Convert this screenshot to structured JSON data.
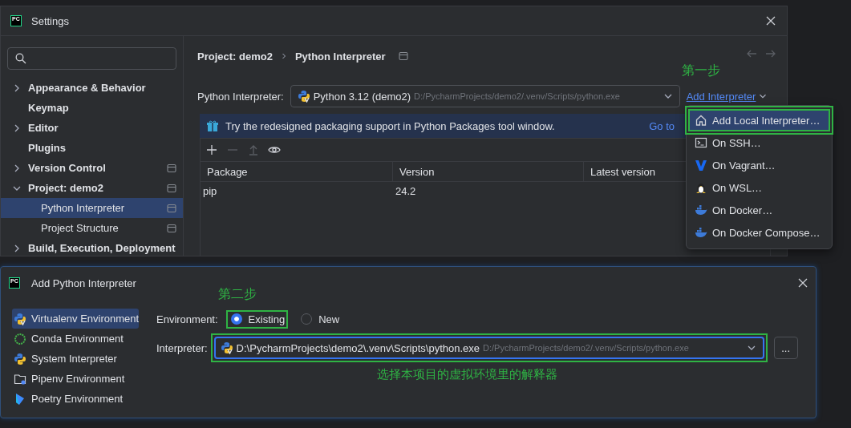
{
  "settings": {
    "logo": "PC",
    "title": "Settings",
    "sidebar": {
      "items": [
        {
          "label": "Appearance & Behavior",
          "kind": "group",
          "expanded": false,
          "selected": false,
          "scope_icon": false
        },
        {
          "label": "Keymap",
          "kind": "page",
          "selected": false,
          "scope_icon": false
        },
        {
          "label": "Editor",
          "kind": "group",
          "expanded": false,
          "selected": false,
          "scope_icon": false
        },
        {
          "label": "Plugins",
          "kind": "page",
          "selected": false,
          "scope_icon": false
        },
        {
          "label": "Version Control",
          "kind": "group",
          "expanded": false,
          "selected": false,
          "scope_icon": true
        },
        {
          "label": "Project: demo2",
          "kind": "group",
          "expanded": true,
          "selected": false,
          "scope_icon": true,
          "children": [
            {
              "label": "Python Interpreter",
              "kind": "page",
              "selected": true,
              "scope_icon": true
            },
            {
              "label": "Project Structure",
              "kind": "page",
              "selected": false,
              "scope_icon": true
            }
          ]
        },
        {
          "label": "Build, Execution, Deployment",
          "kind": "group",
          "expanded": false,
          "selected": false,
          "scope_icon": false
        }
      ]
    },
    "breadcrumb": [
      "Project: demo2",
      "Python Interpreter"
    ],
    "interpreter": {
      "label": "Python Interpreter:",
      "value": "Python 3.12 (demo2)",
      "path": "D:/PycharmProjects/demo2/.venv/Scripts/python.exe"
    },
    "add_interpreter": {
      "label": "Add Interpreter",
      "annotation": "第一步"
    },
    "banner": {
      "text": "Try the redesigned packaging support in Python Packages tool window.",
      "link": "Go to"
    },
    "toolbar": [
      {
        "kind": "add",
        "disabled": false
      },
      {
        "kind": "remove",
        "disabled": true
      },
      {
        "kind": "upgrade",
        "disabled": true
      },
      {
        "kind": "show",
        "disabled": false
      }
    ],
    "table": {
      "columns": [
        "Package",
        "Version",
        "Latest version"
      ],
      "rows": [
        [
          "pip",
          "24.2"
        ]
      ]
    }
  },
  "menu": {
    "items": [
      {
        "label": "Add Local Interpreter…",
        "kind": "home",
        "selected": true,
        "annotated": true
      },
      {
        "label": "On SSH…",
        "kind": "terminal",
        "selected": false,
        "annotated": false
      },
      {
        "label": "On Vagrant…",
        "kind": "vagrant",
        "selected": false,
        "annotated": false
      },
      {
        "label": "On WSL…",
        "kind": "penguin",
        "selected": false,
        "annotated": false
      },
      {
        "label": "On Docker…",
        "kind": "docker",
        "selected": false,
        "annotated": false
      },
      {
        "label": "On Docker Compose…",
        "kind": "docker",
        "selected": false,
        "annotated": false
      }
    ]
  },
  "dialog": {
    "logo": "PC",
    "title": "Add Python Interpreter",
    "sidebar": {
      "items": [
        {
          "label": "Virtualenv Environment",
          "kind": "virtualenv",
          "selected": true
        },
        {
          "label": "Conda Environment",
          "kind": "conda",
          "selected": false
        },
        {
          "label": "System Interpreter",
          "kind": "python",
          "selected": false
        },
        {
          "label": "Pipenv Environment",
          "kind": "pipenv",
          "selected": false
        },
        {
          "label": "Poetry Environment",
          "kind": "poetry",
          "selected": false
        }
      ]
    },
    "annotation": "第二步",
    "environment": {
      "label": "Environment:",
      "options": [
        {
          "label": "Existing",
          "selected": true,
          "annotated": true
        },
        {
          "label": "New",
          "selected": false,
          "annotated": false
        }
      ]
    },
    "interpreter": {
      "label": "Interpreter:",
      "value": "D:\\PycharmProjects\\demo2\\.venv\\Scripts\\python.exe",
      "path": "D:/PycharmProjects/demo2/.venv/Scripts/python.exe",
      "annotated": true,
      "browse": "..."
    },
    "note": "选择本项目的虚拟环境里的解释器"
  }
}
